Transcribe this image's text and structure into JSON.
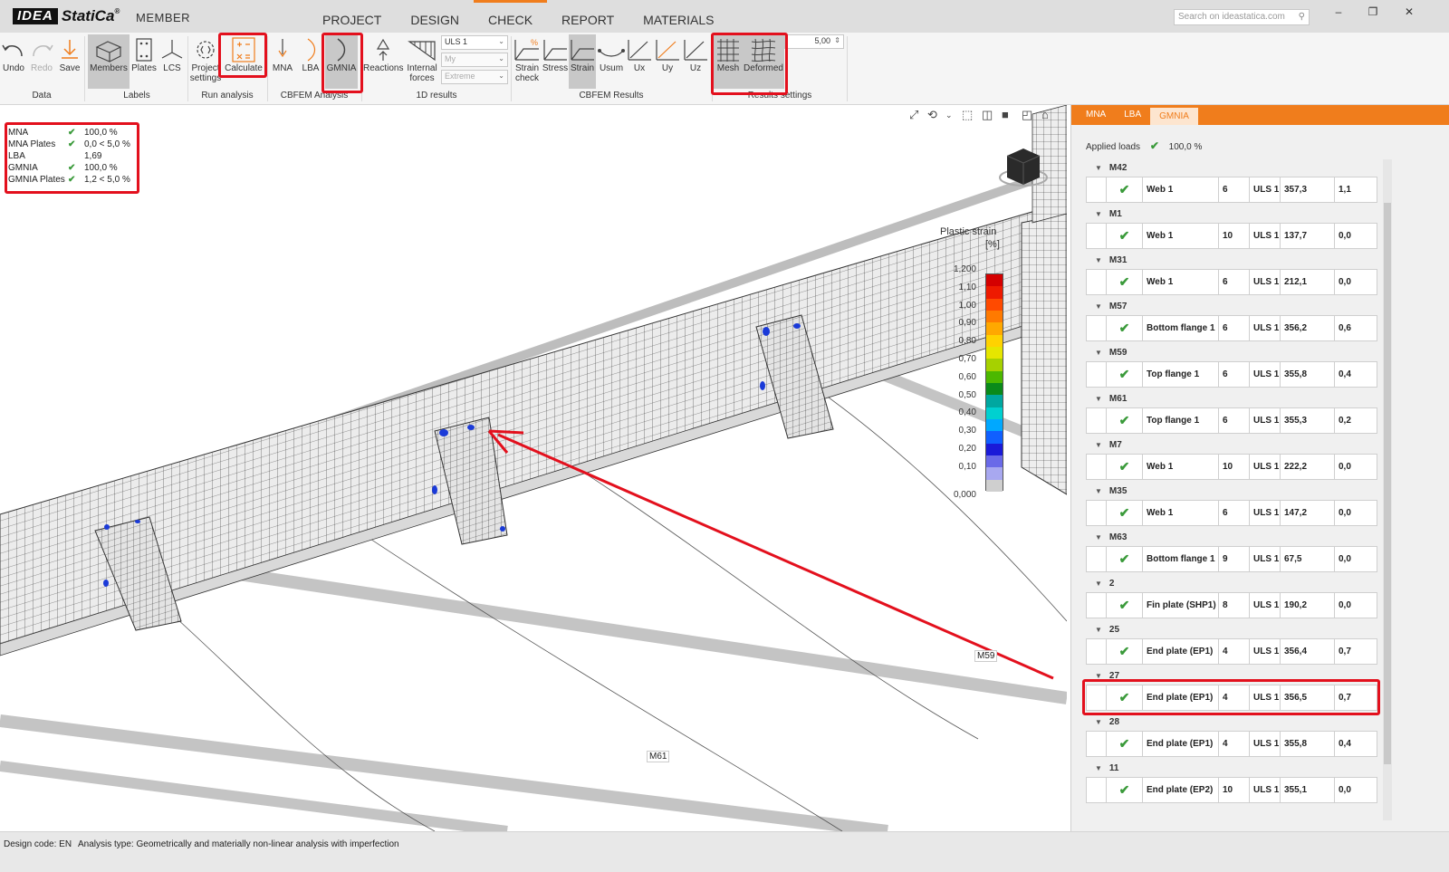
{
  "app": {
    "logo_text": "IDEA",
    "brand": "StatiCa",
    "module": "MEMBER"
  },
  "main_tabs": [
    "PROJECT",
    "DESIGN",
    "CHECK",
    "REPORT",
    "MATERIALS"
  ],
  "active_main_tab": "CHECK",
  "search": {
    "placeholder": "Search on ideastatica.com"
  },
  "window_buttons": {
    "minimize": "–",
    "restore": "❐",
    "close": "✕"
  },
  "ribbon": {
    "data": {
      "undo": "Undo",
      "redo": "Redo",
      "save": "Save",
      "group": "Data"
    },
    "labels": {
      "members": "Members",
      "plates": "Plates",
      "lcs": "LCS",
      "group": "Labels"
    },
    "run": {
      "project_settings": "Project settings",
      "calculate": "Calculate",
      "group": "Run analysis"
    },
    "cbfem_analysis": {
      "mna": "MNA",
      "lba": "LBA",
      "gmnia": "GMNIA",
      "group": "CBFEM Analysis"
    },
    "one_d": {
      "reactions": "Reactions",
      "internal_forces": "Internal forces",
      "combo_case": "ULS 1",
      "combo_component": "My",
      "combo_extreme": "Extreme",
      "group": "1D results"
    },
    "cbfem_results": {
      "strain_check": "Strain check",
      "stress": "Stress",
      "strain": "Strain",
      "usum": "Usum",
      "ux": "Ux",
      "uy": "Uy",
      "uz": "Uz",
      "group": "CBFEM Results"
    },
    "results_settings": {
      "mesh": "Mesh",
      "deformed": "Deformed",
      "scale": "5,00",
      "group": "Results settings"
    }
  },
  "summary": [
    {
      "name": "MNA",
      "value": "100,0 %",
      "check": true
    },
    {
      "name": "MNA Plates",
      "value": "0,0 < 5,0 %",
      "check": true
    },
    {
      "name": "LBA",
      "value": "1,69",
      "check": false
    },
    {
      "name": "GMNIA",
      "value": "100,0 %",
      "check": true
    },
    {
      "name": "GMNIA Plates",
      "value": "1,2 < 5,0 %",
      "check": true
    }
  ],
  "legend": {
    "title": "Plastic strain",
    "unit": "[%]",
    "ticks": [
      "1,200",
      "1,10",
      "1,00",
      "0,90",
      "0,80",
      "0,70",
      "0,60",
      "0,50",
      "0,40",
      "0,30",
      "0,20",
      "0,10",
      "0,000"
    ],
    "colors": [
      "#d40000",
      "#ee1a00",
      "#ff4a00",
      "#ff7a00",
      "#ffa800",
      "#ffd200",
      "#e6e600",
      "#a6d100",
      "#4cb800",
      "#0a8a1a",
      "#00a7a0",
      "#00d0d0",
      "#00a8ff",
      "#1060ff",
      "#1a1ad8",
      "#6a6ae8",
      "#a8a8f0",
      "#cfcfcf"
    ]
  },
  "beam_labels": [
    "M59",
    "M61"
  ],
  "right_panel": {
    "tabs": [
      "MNA",
      "LBA",
      "GMNIA"
    ],
    "active_tab": "GMNIA",
    "applied_loads_label": "Applied loads",
    "applied_loads_value": "100,0 %",
    "groups": [
      {
        "name": "M42",
        "row": {
          "item": "Web 1",
          "n": "6",
          "lc": "ULS 1",
          "stress": "357,3",
          "strain": "1,1"
        }
      },
      {
        "name": "M1",
        "row": {
          "item": "Web 1",
          "n": "10",
          "lc": "ULS 1",
          "stress": "137,7",
          "strain": "0,0"
        }
      },
      {
        "name": "M31",
        "row": {
          "item": "Web 1",
          "n": "6",
          "lc": "ULS 1",
          "stress": "212,1",
          "strain": "0,0"
        }
      },
      {
        "name": "M57",
        "row": {
          "item": "Bottom flange 1",
          "n": "6",
          "lc": "ULS 1",
          "stress": "356,2",
          "strain": "0,6"
        }
      },
      {
        "name": "M59",
        "row": {
          "item": "Top flange 1",
          "n": "6",
          "lc": "ULS 1",
          "stress": "355,8",
          "strain": "0,4"
        }
      },
      {
        "name": "M61",
        "row": {
          "item": "Top flange 1",
          "n": "6",
          "lc": "ULS 1",
          "stress": "355,3",
          "strain": "0,2"
        }
      },
      {
        "name": "M7",
        "row": {
          "item": "Web 1",
          "n": "10",
          "lc": "ULS 1",
          "stress": "222,2",
          "strain": "0,0"
        }
      },
      {
        "name": "M35",
        "row": {
          "item": "Web 1",
          "n": "6",
          "lc": "ULS 1",
          "stress": "147,2",
          "strain": "0,0"
        }
      },
      {
        "name": "M63",
        "row": {
          "item": "Bottom flange 1",
          "n": "9",
          "lc": "ULS 1",
          "stress": "67,5",
          "strain": "0,0"
        }
      },
      {
        "name": "2",
        "row": {
          "item": "Fin plate (SHP1)",
          "n": "8",
          "lc": "ULS 1",
          "stress": "190,2",
          "strain": "0,0"
        }
      },
      {
        "name": "25",
        "row": {
          "item": "End plate (EP1)",
          "n": "4",
          "lc": "ULS 1",
          "stress": "356,4",
          "strain": "0,7"
        }
      },
      {
        "name": "27",
        "row": {
          "item": "End plate (EP1)",
          "n": "4",
          "lc": "ULS 1",
          "stress": "356,5",
          "strain": "0,7"
        }
      },
      {
        "name": "28",
        "row": {
          "item": "End plate (EP1)",
          "n": "4",
          "lc": "ULS 1",
          "stress": "355,8",
          "strain": "0,4"
        }
      },
      {
        "name": "11",
        "row": {
          "item": "End plate (EP2)",
          "n": "10",
          "lc": "ULS 1",
          "stress": "355,1",
          "strain": "0,0"
        }
      }
    ]
  },
  "status": {
    "design_code": "Design code: EN",
    "analysis_type": "Analysis type: Geometrically and materially non-linear analysis with imperfection"
  },
  "colors": {
    "accent": "#f07d1c",
    "highlight": "#e3101d",
    "ok": "#3a9a3a"
  }
}
